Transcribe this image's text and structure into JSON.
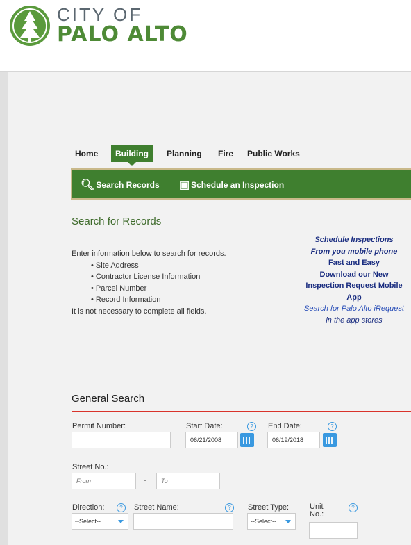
{
  "header": {
    "city": "CITY OF",
    "name": "PALO ALTO"
  },
  "tabs": [
    {
      "label": "Home"
    },
    {
      "label": "Building"
    },
    {
      "label": "Planning"
    },
    {
      "label": "Fire"
    },
    {
      "label": "Public Works"
    }
  ],
  "subnav": {
    "search": "Search Records",
    "schedule": "Schedule an Inspection"
  },
  "search_section": {
    "title": "Search for Records",
    "intro": "Enter information below to search for records.",
    "bullets": [
      "Site Address",
      "Contractor License Information",
      "Parcel Number",
      "Record Information"
    ],
    "note": "It is not necessary to complete all fields."
  },
  "promo": {
    "line1": "Schedule Inspections",
    "line2": "From you mobile phone",
    "line3": "Fast and Easy",
    "line4": "Download our New",
    "line5": "Inspection Request Mobile",
    "line6": "App",
    "line7": "Search for Palo Alto iRequest",
    "line8": "in the app stores"
  },
  "general": {
    "title": "General Search",
    "permit_label": "Permit Number:",
    "start_label": "Start Date:",
    "start_value": "06/21/2008",
    "end_label": "End Date:",
    "end_value": "06/19/2018",
    "street_no_label": "Street No.:",
    "from_placeholder": "From",
    "dash": "-",
    "to_placeholder": "To",
    "direction_label": "Direction:",
    "direction_value": "--Select--",
    "street_name_label": "Street Name:",
    "street_type_label": "Street Type:",
    "street_type_value": "--Select--",
    "unit_label_1": "Unit",
    "unit_label_2": "No.:",
    "help": "?"
  },
  "colors": {
    "brand_green": "#3f7f2f",
    "accent_blue": "#3a99e0",
    "red_rule": "#d9332b"
  }
}
